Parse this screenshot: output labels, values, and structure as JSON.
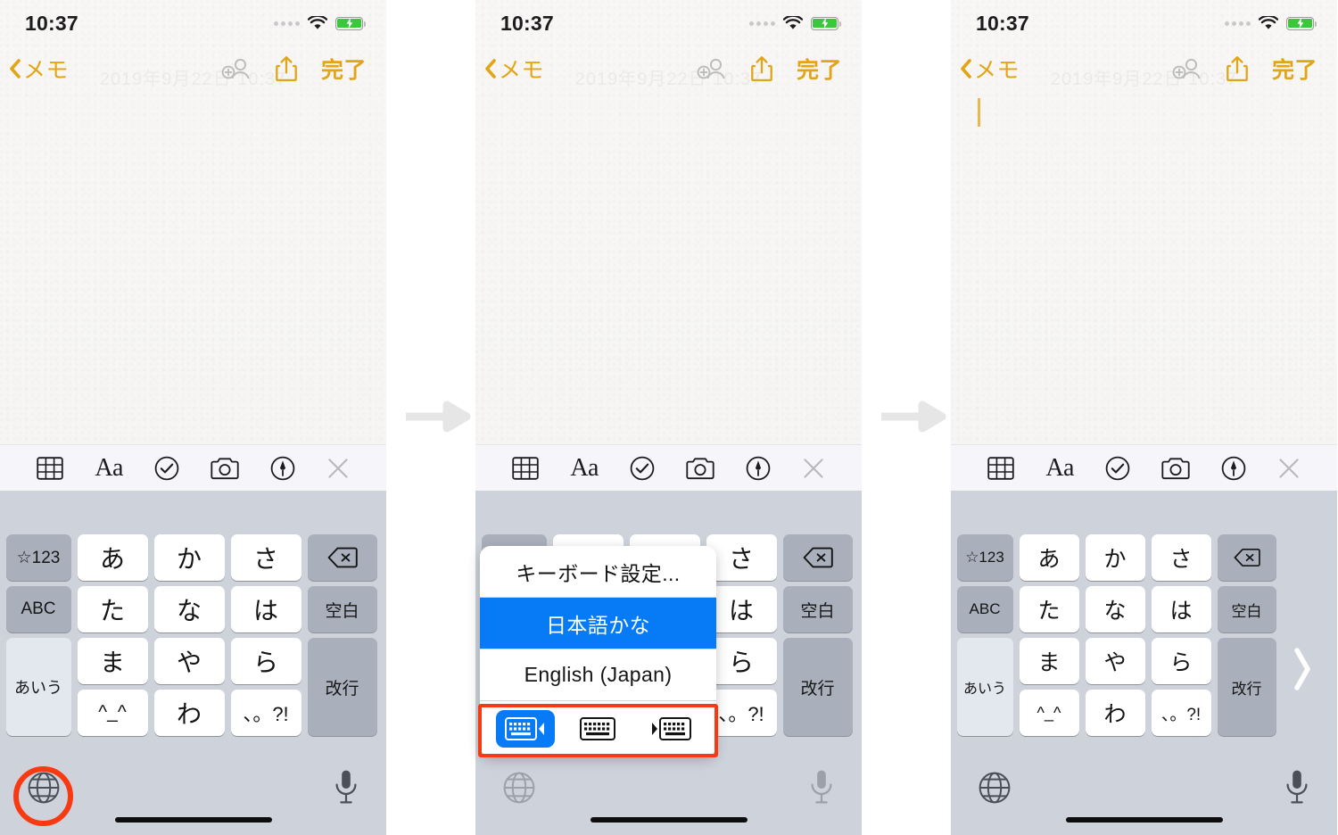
{
  "meta": {
    "flow_arrow_1": "step-arrow",
    "flow_arrow_2": "step-arrow"
  },
  "status_bar": {
    "time": "10:37",
    "signal_icon": "signal-dots-icon",
    "wifi_icon": "wifi-icon",
    "battery_icon": "battery-charging-icon",
    "battery_color": "#37c93a"
  },
  "nav_bar": {
    "back_icon": "chevron-left-icon",
    "back_label": "メモ",
    "collaborate_icon": "add-person-icon",
    "share_icon": "share-icon",
    "done_label": "完了",
    "accent_color": "#e2a517"
  },
  "note": {
    "watermark": "2019年9月22日 10:37",
    "caret": "text-caret"
  },
  "notes_toolbar": {
    "items": [
      {
        "name": "table-icon",
        "label": ""
      },
      {
        "name": "format-aa-icon",
        "label": "Aa"
      },
      {
        "name": "checklist-icon",
        "label": ""
      },
      {
        "name": "camera-icon",
        "label": ""
      },
      {
        "name": "markup-pen-icon",
        "label": ""
      },
      {
        "name": "close-icon",
        "label": ""
      }
    ]
  },
  "keyboard": {
    "background_color": "#ced2da",
    "rows": [
      [
        {
          "label": "☆123",
          "type": "fn",
          "name": "key-symbols"
        },
        {
          "label": "あ",
          "type": "char",
          "name": "key-a"
        },
        {
          "label": "か",
          "type": "char",
          "name": "key-ka"
        },
        {
          "label": "さ",
          "type": "char",
          "name": "key-sa"
        },
        {
          "label": "delete-icon",
          "type": "fn-icon",
          "name": "key-delete"
        }
      ],
      [
        {
          "label": "ABC",
          "type": "fn",
          "name": "key-abc"
        },
        {
          "label": "た",
          "type": "char",
          "name": "key-ta"
        },
        {
          "label": "な",
          "type": "char",
          "name": "key-na"
        },
        {
          "label": "は",
          "type": "char",
          "name": "key-ha"
        },
        {
          "label": "空白",
          "type": "fn",
          "name": "key-space"
        }
      ],
      [
        {
          "label": "あいう",
          "type": "fn-light-span2",
          "name": "key-kana-mode"
        },
        {
          "label": "ま",
          "type": "char",
          "name": "key-ma"
        },
        {
          "label": "や",
          "type": "char",
          "name": "key-ya"
        },
        {
          "label": "ら",
          "type": "char",
          "name": "key-ra"
        },
        {
          "label": "改行",
          "type": "fn-span2",
          "name": "key-return"
        }
      ],
      [
        {
          "label": "^_^",
          "type": "char-small",
          "name": "key-emoticon"
        },
        {
          "label": "わ",
          "type": "char",
          "name": "key-wa"
        },
        {
          "label": "、。?!",
          "type": "char-tiny",
          "name": "key-punctuation"
        }
      ]
    ],
    "bottom": {
      "globe_icon": "globe-icon",
      "mic_icon": "microphone-icon",
      "home_indicator": "home-indicator"
    },
    "expand_chevron": "chevron-right-icon"
  },
  "popup": {
    "settings_label": "キーボード設定...",
    "options": [
      {
        "label": "日本語かな",
        "selected": true,
        "name": "popup-option-japanese-kana"
      },
      {
        "label": "English (Japan)",
        "selected": false,
        "name": "popup-option-english-japan"
      }
    ],
    "layouts": [
      {
        "name": "keyboard-layout-left-icon",
        "active": true
      },
      {
        "name": "keyboard-layout-full-icon",
        "active": false
      },
      {
        "name": "keyboard-layout-right-icon",
        "active": false
      }
    ],
    "selected_color": "#067bf5",
    "highlight_color": "#f83a12"
  },
  "annotations": {
    "globe_highlight": "red-circle-highlight",
    "layout_highlight": "red-rectangle-highlight",
    "color": "#f83a12"
  }
}
